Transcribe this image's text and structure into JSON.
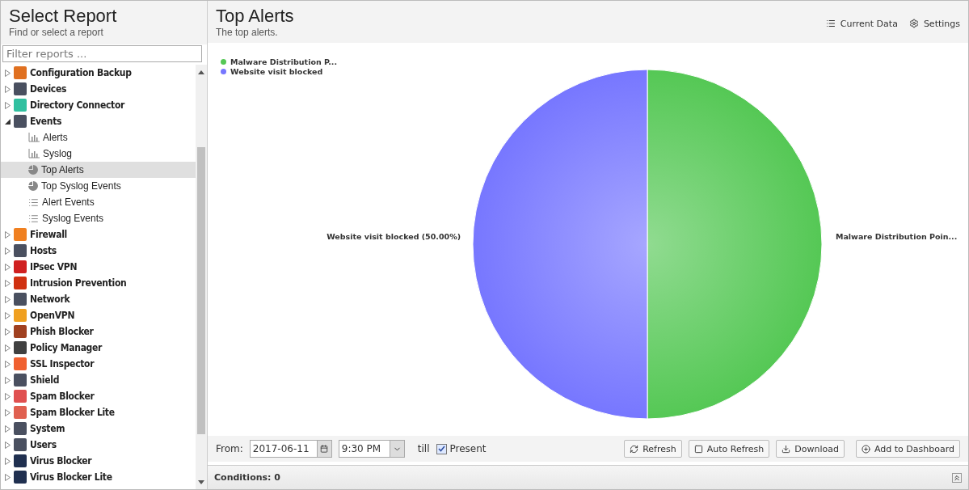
{
  "sidebar": {
    "title": "Select Report",
    "subtitle": "Find or select a report",
    "filter": {
      "placeholder": "Filter reports ..."
    },
    "items": [
      {
        "label": "Configuration Backup",
        "color": "#e07020",
        "expanded": false,
        "selected": false
      },
      {
        "label": "Devices",
        "color": "#4a5060",
        "expanded": false,
        "selected": false
      },
      {
        "label": "Directory Connector",
        "color": "#30c0a0",
        "expanded": false,
        "selected": false
      },
      {
        "label": "Events",
        "color": "#4a5060",
        "expanded": true,
        "selected": false,
        "children": [
          {
            "label": "Alerts",
            "kind": "bar",
            "selected": false
          },
          {
            "label": "Syslog",
            "kind": "bar",
            "selected": false
          },
          {
            "label": "Top Alerts",
            "kind": "pie",
            "selected": true
          },
          {
            "label": "Top Syslog Events",
            "kind": "pie",
            "selected": false
          },
          {
            "label": "Alert Events",
            "kind": "list",
            "selected": false
          },
          {
            "label": "Syslog Events",
            "kind": "list",
            "selected": false
          }
        ]
      },
      {
        "label": "Firewall",
        "color": "#f08020",
        "expanded": false,
        "selected": false
      },
      {
        "label": "Hosts",
        "color": "#4a5060",
        "expanded": false,
        "selected": false
      },
      {
        "label": "IPsec VPN",
        "color": "#d02020",
        "expanded": false,
        "selected": false
      },
      {
        "label": "Intrusion Prevention",
        "color": "#d03010",
        "expanded": false,
        "selected": false
      },
      {
        "label": "Network",
        "color": "#4a5060",
        "expanded": false,
        "selected": false
      },
      {
        "label": "OpenVPN",
        "color": "#f0a020",
        "expanded": false,
        "selected": false
      },
      {
        "label": "Phish Blocker",
        "color": "#a04020",
        "expanded": false,
        "selected": false
      },
      {
        "label": "Policy Manager",
        "color": "#404040",
        "expanded": false,
        "selected": false
      },
      {
        "label": "SSL Inspector",
        "color": "#f06030",
        "expanded": false,
        "selected": false
      },
      {
        "label": "Shield",
        "color": "#4a5060",
        "expanded": false,
        "selected": false
      },
      {
        "label": "Spam Blocker",
        "color": "#e05050",
        "expanded": false,
        "selected": false
      },
      {
        "label": "Spam Blocker Lite",
        "color": "#e06050",
        "expanded": false,
        "selected": false
      },
      {
        "label": "System",
        "color": "#4a5060",
        "expanded": false,
        "selected": false
      },
      {
        "label": "Users",
        "color": "#4a5060",
        "expanded": false,
        "selected": false
      },
      {
        "label": "Virus Blocker",
        "color": "#203050",
        "expanded": false,
        "selected": false
      },
      {
        "label": "Virus Blocker Lite",
        "color": "#203050",
        "expanded": false,
        "selected": false
      }
    ]
  },
  "report": {
    "title": "Top Alerts",
    "subtitle": "The top alerts.",
    "actions": [
      "Current Data",
      "Settings"
    ],
    "legend": [
      {
        "label": "Malware Distribution P...",
        "color": "#55c855"
      },
      {
        "label": "Website visit blocked",
        "color": "#7777ff"
      }
    ],
    "chart_data": {
      "type": "pie",
      "values": [
        50,
        50
      ],
      "value_labels": [
        "Malware Distribution Poin...",
        "Website visit blocked (50.00%)"
      ]
    }
  },
  "toolbar": {
    "from_label": "From:",
    "date": "2017-06-11",
    "time": "9:30 PM",
    "till_label": "till",
    "present": {
      "label": "Present",
      "checked": true
    },
    "buttons": [
      {
        "label": "Refresh",
        "kind": "refresh"
      },
      {
        "label": "Auto Refresh",
        "kind": "toggle"
      },
      {
        "label": "Download",
        "kind": "download"
      },
      {
        "label": "Add to Dashboard",
        "kind": "add"
      }
    ]
  },
  "conditions": {
    "label": "Conditions: 0"
  }
}
